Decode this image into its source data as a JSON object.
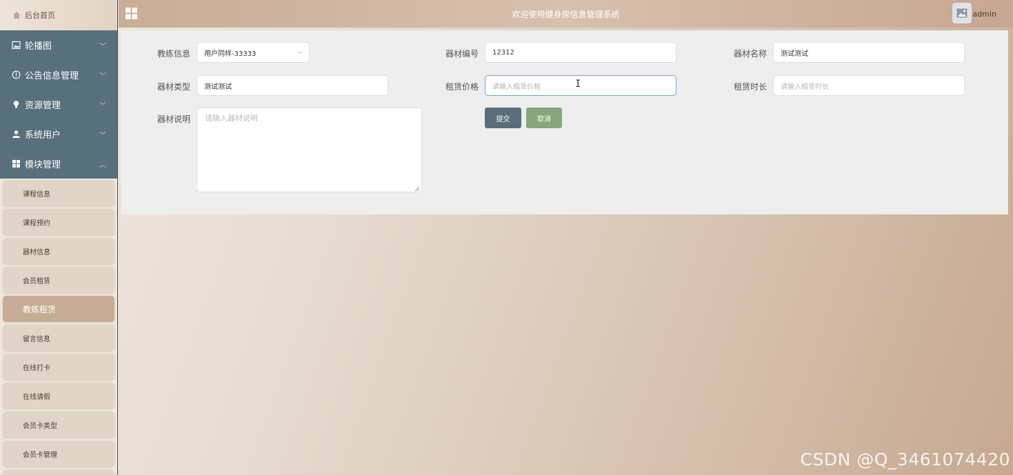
{
  "sidebar": {
    "home": {
      "label": "后台首页",
      "icon": "home-icon"
    },
    "menus": [
      {
        "label": "轮播图",
        "icon": "image-icon",
        "chevron": "﹀"
      },
      {
        "label": "公告信息管理",
        "icon": "info-circle-icon",
        "chevron": "﹀"
      },
      {
        "label": "资源管理",
        "icon": "bulb-icon",
        "chevron": "﹀"
      },
      {
        "label": "系统用户",
        "icon": "user-icon",
        "chevron": "﹀"
      },
      {
        "label": "模块管理",
        "icon": "grid-icon",
        "chevron": "︿"
      }
    ],
    "submenu": [
      {
        "label": "课程信息"
      },
      {
        "label": "课程预约"
      },
      {
        "label": "器材信息"
      },
      {
        "label": "会员租赁"
      },
      {
        "label": "教练租赁",
        "active": true
      },
      {
        "label": "留言信息"
      },
      {
        "label": "在线打卡"
      },
      {
        "label": "在线请假"
      },
      {
        "label": "会员卡类型"
      },
      {
        "label": "会员卡管理"
      }
    ]
  },
  "header": {
    "title": "欢迎使用健身房信息管理系统",
    "username": "admin"
  },
  "form": {
    "coach": {
      "label": "教练信息",
      "value": "用户同样-33333"
    },
    "equip_no": {
      "label": "器材编号",
      "value": "12312"
    },
    "equip_name": {
      "label": "器材名称",
      "value": "测试测试"
    },
    "equip_type": {
      "label": "器材类型",
      "value": "测试测试"
    },
    "price": {
      "label": "租赁价格",
      "placeholder": "请输入租赁价格"
    },
    "duration": {
      "label": "租赁时长",
      "placeholder": "请输入租赁时长"
    },
    "desc": {
      "label": "器材说明",
      "placeholder": "请输入器材说明"
    },
    "submit_label": "提交",
    "cancel_label": "取消"
  },
  "watermark": "CSDN @Q_3461074420",
  "colors": {
    "sidebar": "#586f7c",
    "header": "#c9ad97",
    "submit": "#5a6e79",
    "cancel": "#86a67c",
    "active_sub": "#c7ac95"
  }
}
